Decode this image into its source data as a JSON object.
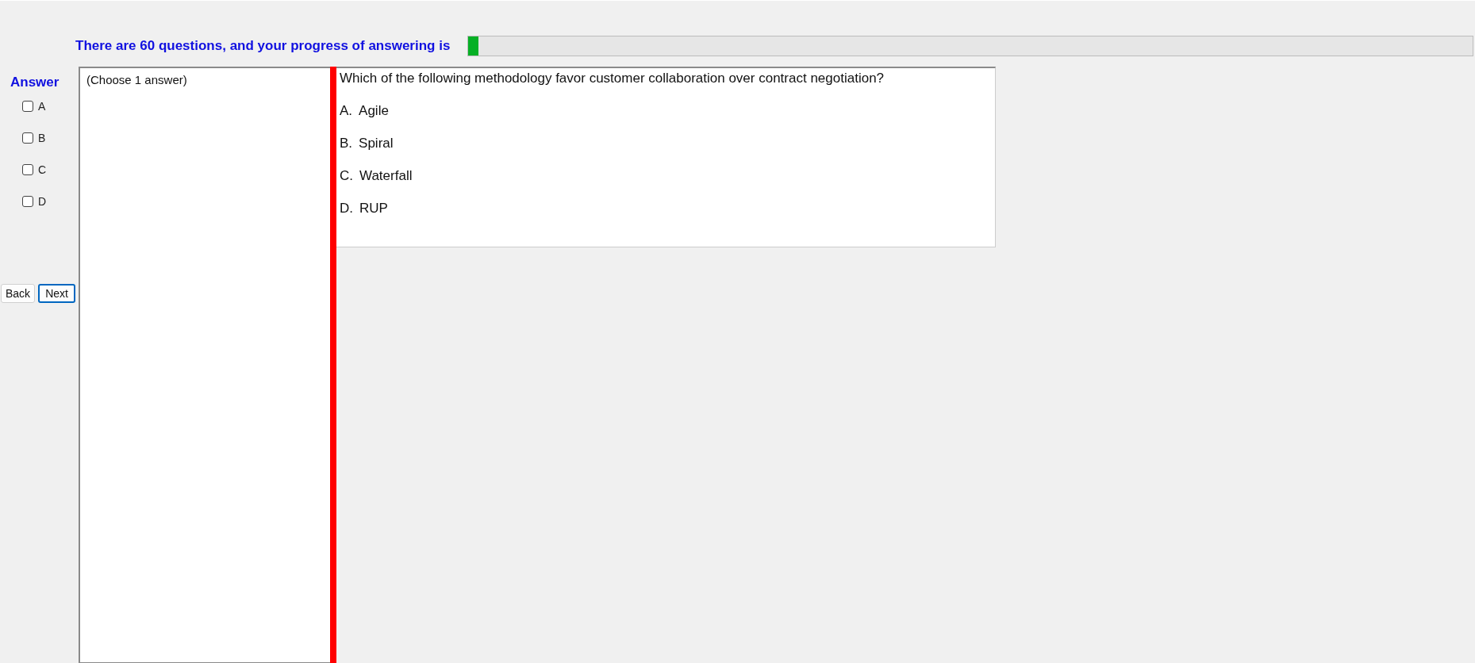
{
  "progress": {
    "text": "There are 60 questions, and your progress of answering is",
    "level": 0.01
  },
  "answer": {
    "label": "Answer",
    "options": [
      {
        "letter": "A",
        "checked": false
      },
      {
        "letter": "B",
        "checked": false
      },
      {
        "letter": "C",
        "checked": false
      },
      {
        "letter": "D",
        "checked": false
      }
    ]
  },
  "buttons": [
    {
      "label": "Back",
      "focused": false
    },
    {
      "label": "Next",
      "focused": true
    }
  ],
  "instructions": "(Choose 1 answer)",
  "question": {
    "text": "Which of the following methodology favor customer collaboration over contract negotiation?",
    "choices": [
      {
        "letter": "A.",
        "text": "Agile"
      },
      {
        "letter": "B.",
        "text": "Spiral"
      },
      {
        "letter": "C.",
        "text": "Waterfall"
      },
      {
        "letter": "D.",
        "text": "RUP"
      }
    ]
  }
}
